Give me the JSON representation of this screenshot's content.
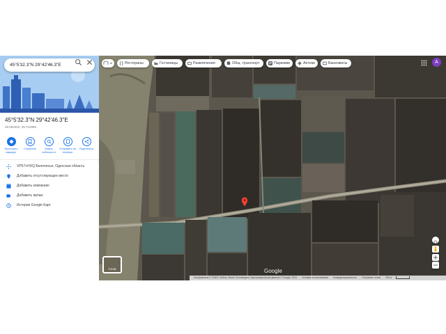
{
  "search": {
    "value": "45°5'32.3\"N 29°42'46.3\"E"
  },
  "place": {
    "title": "45°5'32.3\"N 29°42'46.3\"E",
    "coords_decimal": "45.092302, 29.712855"
  },
  "actions": [
    {
      "label": "Проложить маршрут",
      "icon": "directions-icon"
    },
    {
      "label": "Сохранить",
      "icon": "bookmark-icon"
    },
    {
      "label": "Искать поблизости",
      "icon": "nearby-icon"
    },
    {
      "label": "Отправить на телефон",
      "icon": "phone-icon"
    },
    {
      "label": "Поделиться",
      "icon": "share-icon"
    }
  ],
  "info": [
    {
      "text": "VP57+HXQ Белолесье, Одесская область",
      "icon": "plus-code-icon"
    },
    {
      "text": "Добавить отсутствующее место",
      "icon": "add-place-icon"
    },
    {
      "text": "Добавить компанию",
      "icon": "business-icon"
    },
    {
      "text": "Добавить ярлык",
      "icon": "label-icon"
    },
    {
      "text": "История Google Карт",
      "icon": "history-icon"
    }
  ],
  "chips": [
    {
      "label": "Рестораны",
      "icon": "restaurant-icon"
    },
    {
      "label": "Гостиницы",
      "icon": "hotel-icon"
    },
    {
      "label": "Развлечения",
      "icon": "entertainment-icon"
    },
    {
      "label": "Общ. транспорт",
      "icon": "transit-icon"
    },
    {
      "label": "Парковки",
      "icon": "parking-icon"
    },
    {
      "label": "Аптеки",
      "icon": "pharmacy-icon"
    },
    {
      "label": "Банкоматы",
      "icon": "atm-icon"
    }
  ],
  "map": {
    "logo": "Google",
    "layers_label": "Слои",
    "footer": [
      "Изображения © CNES / Airbus, Maxar Technologies, Картографические данные © Google, 2021",
      "Условия использования",
      "Конфиденциальность",
      "Отправить отзыв",
      "200 м"
    ]
  },
  "user": {
    "initial": "A"
  },
  "colors": {
    "accent": "#1a73e8",
    "pin": "#ea4335",
    "avatar": "#7b3fbf"
  }
}
